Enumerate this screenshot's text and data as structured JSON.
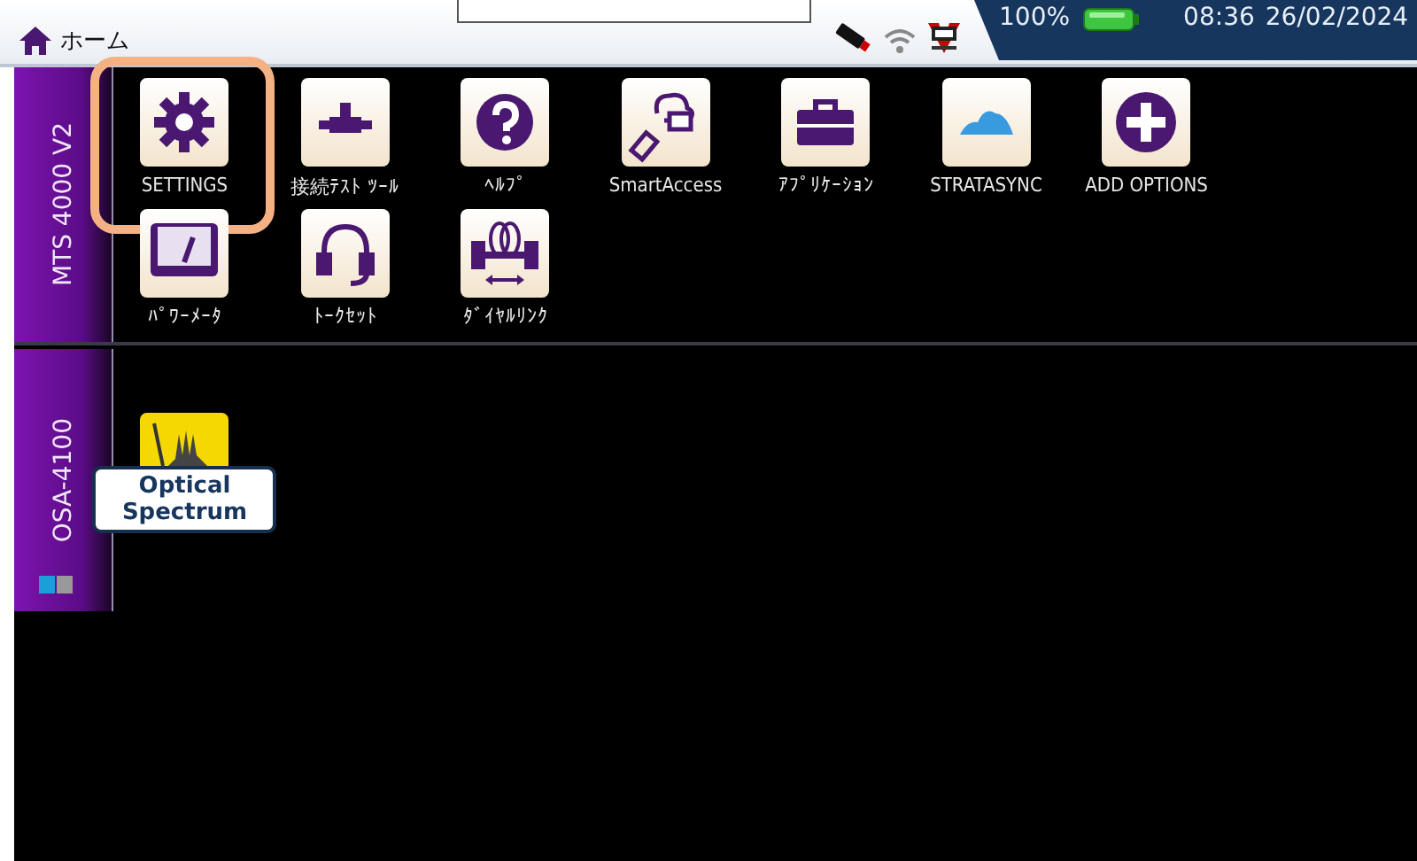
{
  "top_bar": {
    "title": "ホーム",
    "battery_text": "100%",
    "time": "08:36",
    "date": "26/02/2024"
  },
  "modules": [
    {
      "label": "MTS 4000 V2",
      "apps": [
        {
          "label": "SETTINGS",
          "highlighted": true
        },
        {
          "label": "接続ﾃｽﾄ ﾂｰﾙ",
          "highlighted": false
        },
        {
          "label": "ﾍﾙﾌﾟ",
          "highlighted": false
        },
        {
          "label": "SmartAccess",
          "highlighted": false
        },
        {
          "label": "ｱﾌﾟﾘｹｰｼｮﾝ",
          "highlighted": false
        },
        {
          "label": "STRATASYNC",
          "highlighted": false
        },
        {
          "label": "ADD OPTIONS",
          "highlighted": false
        },
        {
          "label": "ﾊﾟﾜｰﾒｰﾀ",
          "highlighted": false
        },
        {
          "label": "ﾄｰｸｾｯﾄ",
          "highlighted": false
        },
        {
          "label": "ﾀﾞｲﾔﾙﾘﾝｸ",
          "highlighted": false
        }
      ]
    },
    {
      "label": "OSA-4100",
      "apps": [
        {
          "label": "Optical Spectrum",
          "highlighted": false
        }
      ]
    }
  ]
}
